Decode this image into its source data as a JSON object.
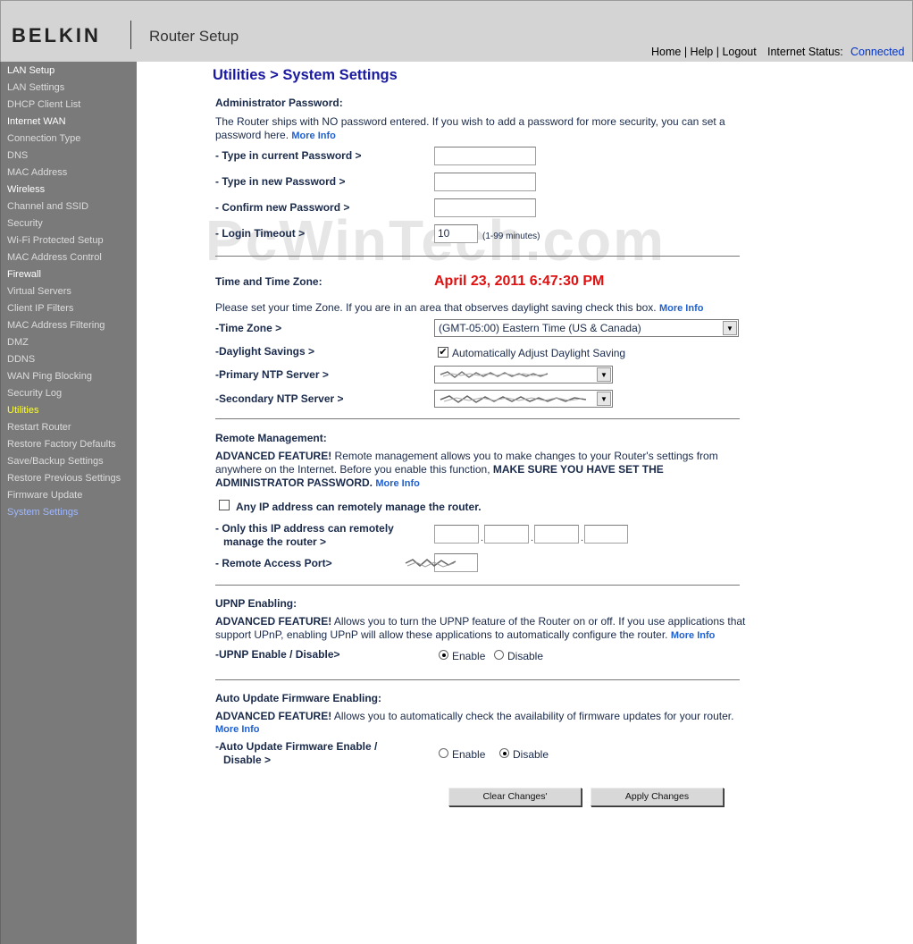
{
  "header": {
    "logo": "BELKIN",
    "product": "Router Setup",
    "home": "Home",
    "help": "Help",
    "logout": "Logout",
    "status_label": "Internet Status:",
    "status_value": "Connected",
    "status_color": "#0033cc"
  },
  "sidebar": {
    "items": [
      {
        "label": "LAN Setup",
        "type": "section"
      },
      {
        "label": "LAN Settings",
        "type": "link"
      },
      {
        "label": "DHCP Client List",
        "type": "link"
      },
      {
        "label": "Internet WAN",
        "type": "section"
      },
      {
        "label": "Connection Type",
        "type": "link"
      },
      {
        "label": "DNS",
        "type": "link"
      },
      {
        "label": "MAC Address",
        "type": "link"
      },
      {
        "label": "Wireless",
        "type": "section"
      },
      {
        "label": "Channel and SSID",
        "type": "link"
      },
      {
        "label": "Security",
        "type": "link"
      },
      {
        "label": "Wi-Fi Protected Setup",
        "type": "link"
      },
      {
        "label": "MAC Address Control",
        "type": "link"
      },
      {
        "label": "Firewall",
        "type": "section"
      },
      {
        "label": "Virtual Servers",
        "type": "link"
      },
      {
        "label": "Client IP Filters",
        "type": "link"
      },
      {
        "label": "MAC Address Filtering",
        "type": "link"
      },
      {
        "label": "DMZ",
        "type": "link"
      },
      {
        "label": "DDNS",
        "type": "link"
      },
      {
        "label": "WAN Ping Blocking",
        "type": "link"
      },
      {
        "label": "Security Log",
        "type": "link"
      },
      {
        "label": "Utilities",
        "type": "active"
      },
      {
        "label": "Restart Router",
        "type": "link"
      },
      {
        "label": "Restore Factory Defaults",
        "type": "link"
      },
      {
        "label": "Save/Backup Settings",
        "type": "link"
      },
      {
        "label": "Restore Previous Settings",
        "type": "link"
      },
      {
        "label": "Firmware Update",
        "type": "link"
      },
      {
        "label": "System Settings",
        "type": "current"
      }
    ]
  },
  "page_title": "Utilities > System Settings",
  "watermark": "PcWinTech.com",
  "admin": {
    "heading": "Administrator Password:",
    "desc_line1": "The Router ships with NO password entered. If you wish to add a password for more security, you can set a",
    "desc_line2": "password here.",
    "more_info": "More Info",
    "current_label": "- Type in current Password >",
    "new_label": "- Type in new Password >",
    "confirm_label": "- Confirm new Password >",
    "timeout_label": "- Login Timeout >",
    "timeout_value": "10",
    "timeout_hint": "(1-99 minutes)"
  },
  "time": {
    "heading": "Time and Time Zone:",
    "datetime": "April 23, 2011   6:47:30 PM",
    "desc": "Please set your time Zone. If you are in an area that observes daylight saving check this box.",
    "more_info": "More Info",
    "tz_label": "-Time Zone >",
    "tz_value": "(GMT-05:00) Eastern Time (US & Canada)",
    "dst_label": "-Daylight Savings >",
    "dst_text": "Automatically Adjust Daylight Saving",
    "dst_checked": true,
    "primary_label": "-Primary NTP Server >",
    "secondary_label": "-Secondary NTP Server >"
  },
  "remote": {
    "heading": "Remote Management:",
    "adv": "ADVANCED FEATURE!",
    "desc1": " Remote management allows you to make changes to your Router's settings from",
    "desc2": "anywhere on the Internet. Before you enable this function,",
    "desc2_bold": "MAKE SURE YOU HAVE SET THE",
    "desc3_bold": "ADMINISTRATOR PASSWORD.",
    "more_info": "More Info",
    "any_ip_label": "Any IP address can remotely manage the router.",
    "only_ip_line1": "- Only this IP address can remotely",
    "only_ip_line2": "manage the router >",
    "port_label": "- Remote Access Port>"
  },
  "upnp": {
    "heading": "UPNP Enabling:",
    "adv": "ADVANCED FEATURE!",
    "desc1": " Allows you to turn the UPNP feature of the Router on or off. If you use applications that",
    "desc2": "support UPnP, enabling UPnP will allow these applications to automatically configure the router.",
    "more_info": "More Info",
    "label": "-UPNP Enable / Disable>",
    "enable": "Enable",
    "disable": "Disable",
    "selected": "enable"
  },
  "firmware": {
    "heading": "Auto Update Firmware Enabling:",
    "adv": "ADVANCED FEATURE!",
    "desc1": " Allows you to automatically check the availability of firmware updates for your router.",
    "more_info": "More Info",
    "label1": "-Auto Update Firmware Enable /",
    "label2": "Disable >",
    "enable": "Enable",
    "disable": "Disable",
    "selected": "disable"
  },
  "buttons": {
    "clear": "Clear Changes'",
    "apply": "Apply Changes"
  }
}
